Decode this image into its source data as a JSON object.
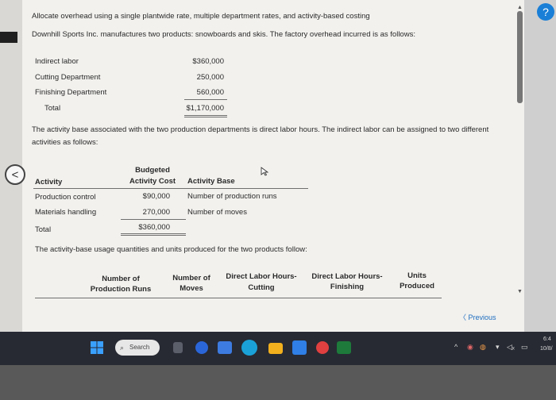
{
  "header": {
    "title": "Allocate overhead using a single plantwide rate, multiple department rates, and activity-based costing",
    "intro": "Downhill Sports Inc. manufactures two products: snowboards and skis. The factory overhead incurred is as follows:"
  },
  "overhead": {
    "rows": [
      {
        "label": "Indirect labor",
        "value": "$360,000"
      },
      {
        "label": "Cutting Department",
        "value": "250,000"
      },
      {
        "label": "Finishing Department",
        "value": "560,000"
      }
    ],
    "total_label": "Total",
    "total_value": "$1,170,000"
  },
  "activity_intro_line1": "The activity base associated with the two production departments is direct labor hours. The indirect labor can be assigned to two different",
  "activity_intro_line2": "activities as follows:",
  "activity_table": {
    "headers": {
      "activity": "Activity",
      "budgeted_1": "Budgeted",
      "budgeted_2": "Activity Cost",
      "base": "Activity Base"
    },
    "rows": [
      {
        "activity": "Production control",
        "cost": "$90,000",
        "base": "Number of production runs"
      },
      {
        "activity": "Materials handling",
        "cost": "270,000",
        "base": "Number of moves"
      }
    ],
    "total_label": "Total",
    "total_value": "$360,000"
  },
  "usage_intro": "The activity-base usage quantities and units produced for the two products follow:",
  "usage_table": {
    "headers": [
      {
        "l1": "Number of",
        "l2": "Production Runs"
      },
      {
        "l1": "Number of",
        "l2": "Moves"
      },
      {
        "l1": "Direct Labor Hours-",
        "l2": "Cutting"
      },
      {
        "l1": "Direct Labor Hours-",
        "l2": "Finishing"
      },
      {
        "l1": "Units",
        "l2": "Produced"
      }
    ]
  },
  "nav": {
    "previous_label": "Previous",
    "back_glyph": "<"
  },
  "taskbar": {
    "search_label": "Search"
  },
  "tray": {
    "time": "6:4",
    "date": "10/8/"
  },
  "help_glyph": "?"
}
